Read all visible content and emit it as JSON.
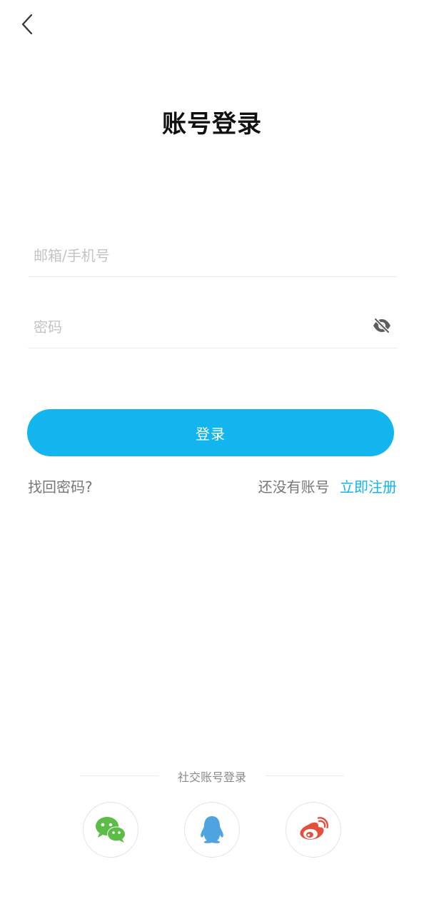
{
  "header": {
    "back_icon": "chevron-left-icon",
    "title": "账号登录"
  },
  "form": {
    "email_placeholder": "邮箱/手机号",
    "email_value": "",
    "password_placeholder": "密码",
    "password_value": "",
    "password_toggle_icon": "eye-off-icon",
    "submit_label": "登录"
  },
  "links": {
    "forgot_password": "找回密码?",
    "no_account": "还没有账号",
    "register": "立即注册"
  },
  "social": {
    "title": "社交账号登录",
    "providers": [
      {
        "name": "wechat",
        "icon": "wechat-icon",
        "color": "#5bbd45"
      },
      {
        "name": "qq",
        "icon": "qq-icon",
        "color": "#4ea3e0"
      },
      {
        "name": "weibo",
        "icon": "weibo-icon",
        "color": "#e4503d"
      }
    ]
  },
  "colors": {
    "accent": "#12b5ee",
    "title": "#111111",
    "muted": "#777777",
    "placeholder": "#c4c4c4"
  }
}
